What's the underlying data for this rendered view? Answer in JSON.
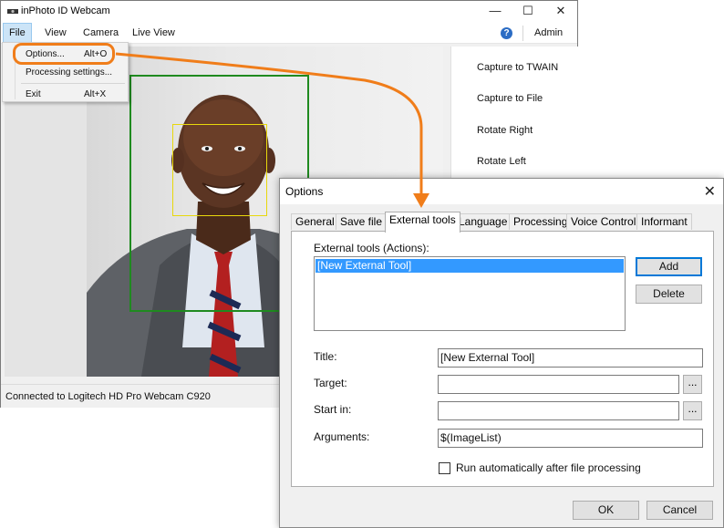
{
  "app": {
    "title": "inPhoto ID Webcam",
    "window_controls": {
      "minimize": "—",
      "maximize": "☐",
      "close": "✕"
    }
  },
  "menubar": {
    "items": [
      {
        "label": "File",
        "active": true
      },
      {
        "label": "View"
      },
      {
        "label": "Camera"
      },
      {
        "label": "Live View"
      }
    ],
    "help_icon": "?",
    "admin_label": "Admin"
  },
  "file_menu": {
    "items": [
      {
        "label": "Options...",
        "shortcut": "Alt+O"
      },
      {
        "label": "Processing settings..."
      },
      {
        "label": "Exit",
        "shortcut": "Alt+X"
      }
    ]
  },
  "side_panel": {
    "buttons": [
      "Capture to TWAIN",
      "Capture to File",
      "Rotate Right",
      "Rotate Left"
    ]
  },
  "status_bar": {
    "text": "Connected to Logitech HD Pro Webcam C920"
  },
  "dialog": {
    "title": "Options",
    "close_glyph": "✕",
    "tabs": [
      "General",
      "Save file",
      "External tools",
      "Language",
      "Processing",
      "Voice Control",
      "Informant"
    ],
    "active_tab": "External tools",
    "tools_list_label": "External tools (Actions):",
    "tools_list_items": [
      "[New External Tool]"
    ],
    "add_button": "Add",
    "delete_button": "Delete",
    "title_label": "Title:",
    "title_value": "[New External Tool]",
    "target_label": "Target:",
    "target_value": "",
    "start_in_label": "Start in:",
    "start_in_value": "",
    "browse_glyph": "...",
    "arguments_label": "Arguments:",
    "arguments_value": "$(ImageList)",
    "run_auto_label": "Run automatically after file processing",
    "run_auto_checked": false,
    "ok_button": "OK",
    "cancel_button": "Cancel"
  },
  "colors": {
    "highlight_orange": "#f07d1a",
    "face_frame_green": "#1f8a1f",
    "face_frame_yellow": "#e8d80c",
    "selection_blue": "#3399ff",
    "accent_blue": "#0078d7"
  }
}
